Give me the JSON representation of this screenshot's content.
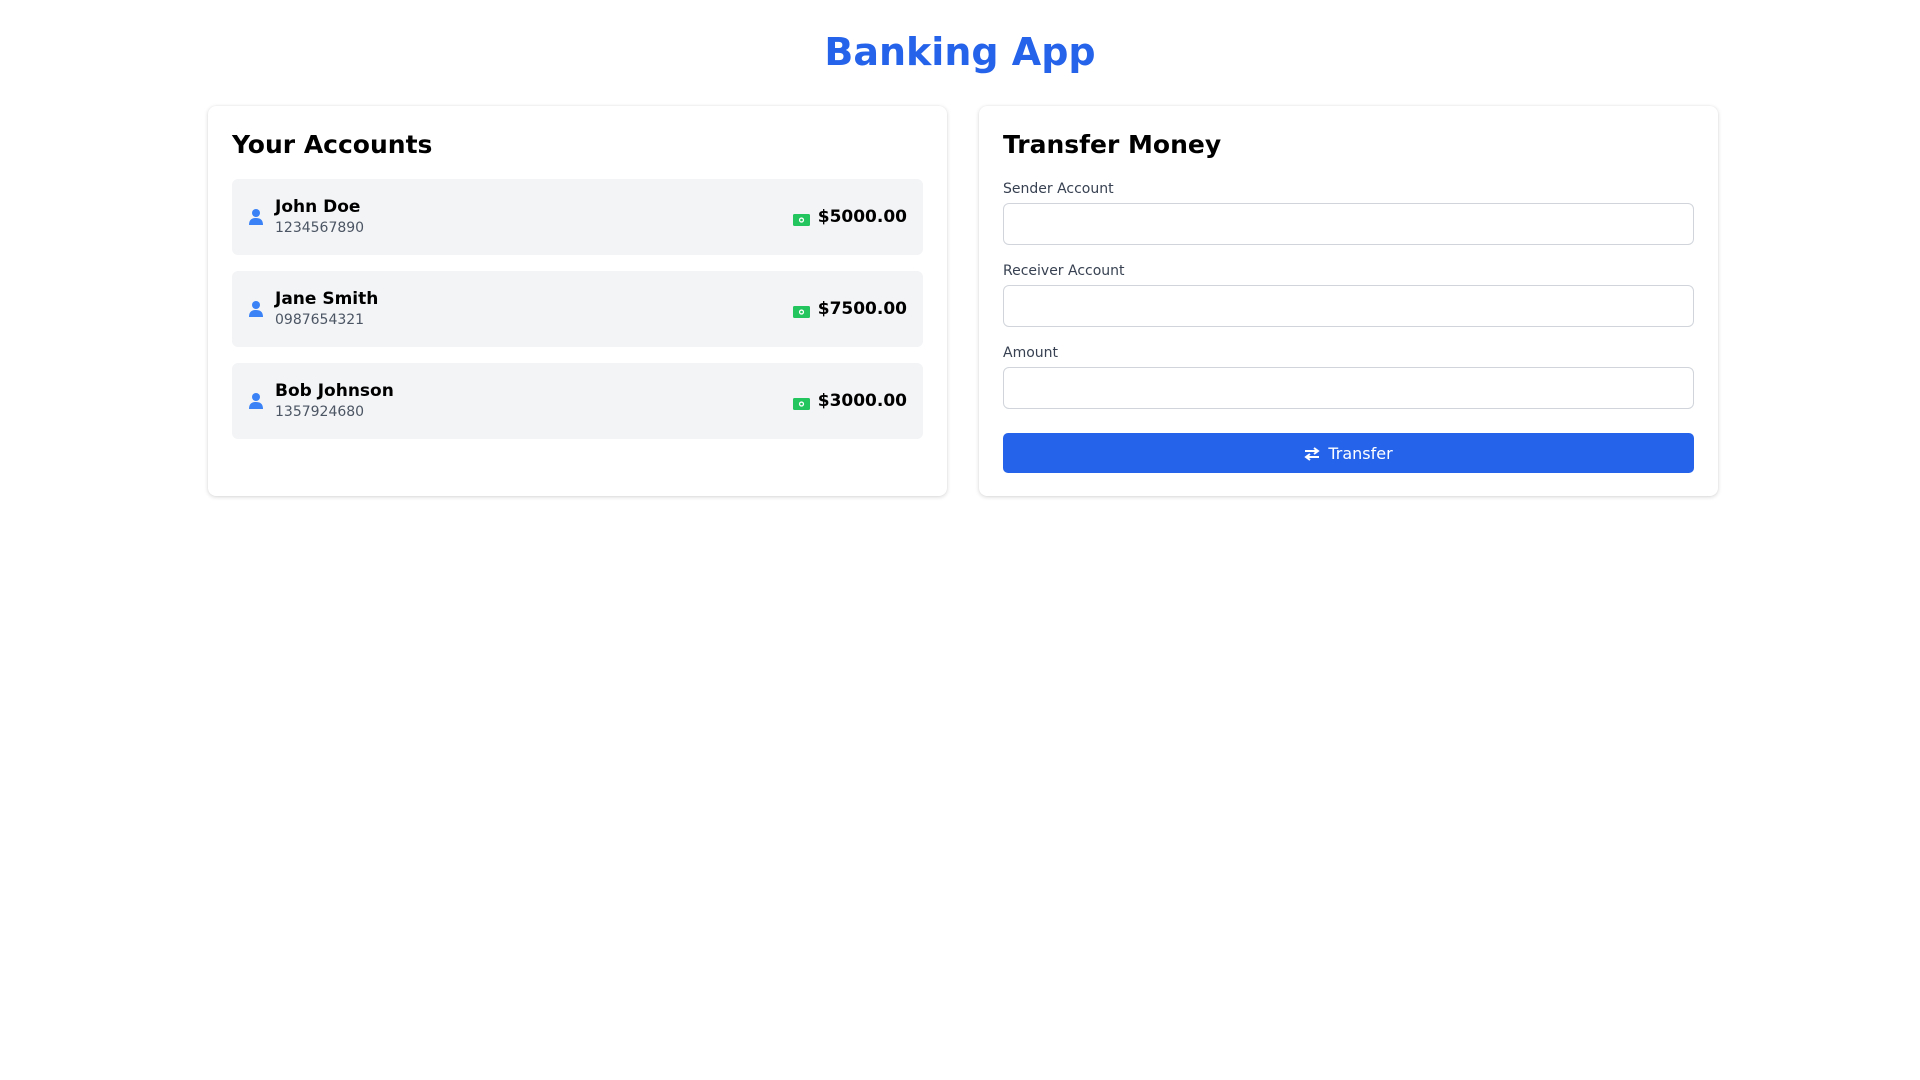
{
  "app": {
    "title": "Banking App"
  },
  "accounts_panel": {
    "title": "Your Accounts",
    "accounts": [
      {
        "name": "John Doe",
        "number": "1234567890",
        "balance": "$5000.00"
      },
      {
        "name": "Jane Smith",
        "number": "0987654321",
        "balance": "$7500.00"
      },
      {
        "name": "Bob Johnson",
        "number": "1357924680",
        "balance": "$3000.00"
      }
    ]
  },
  "transfer_panel": {
    "title": "Transfer Money",
    "sender_label": "Sender Account",
    "sender_value": "",
    "receiver_label": "Receiver Account",
    "receiver_value": "",
    "amount_label": "Amount",
    "amount_value": "",
    "button_label": "Transfer"
  },
  "icons": {
    "user": "user-icon",
    "money": "money-bill-icon",
    "transfer": "exchange-arrows-icon"
  },
  "colors": {
    "primary": "#2563eb",
    "money_green": "#22c55e",
    "user_icon": "#3b82f6",
    "card_bg": "#f3f4f6"
  }
}
